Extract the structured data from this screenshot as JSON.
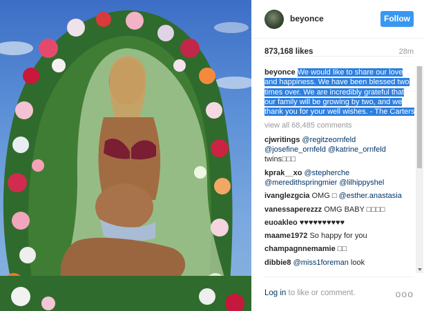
{
  "post": {
    "username": "beyonce",
    "follow_label": "Follow",
    "likes": "873,168 likes",
    "time": "28m",
    "caption_user": "beyonce",
    "caption_text": "We would like to share our love and happiness. We have been blessed two times over. We are incredibly grateful that our family will be growing by two, and we thank you for your well wishes. - The Carters",
    "view_all": "view all 68,485 comments"
  },
  "comments": [
    {
      "user": "cjwritings",
      "mentions": "@regitzeornfeld @josefine_ornfeld @katrine_ornfeld",
      "text": "twins□□□"
    },
    {
      "user": "kprak__xo",
      "mentions": "@stepherche @meredithspringmier @lilhippyshel",
      "text": ""
    },
    {
      "user": "ivanglezgcia",
      "text_before": "OMG □",
      "mentions": "@esther.anastasia",
      "text": ""
    },
    {
      "user": "vanessaperezzz",
      "text": "OMG BABY □□□□"
    },
    {
      "user": "euoakleo",
      "text": "♥♥♥♥♥♥♥♥♥♥"
    },
    {
      "user": "maame1972",
      "text": "So happy for you"
    },
    {
      "user": "champagnnemamie",
      "text": "□□"
    },
    {
      "user": "dibbie8",
      "mentions": "@miss1foreman",
      "text": "look"
    }
  ],
  "footer": {
    "login_label": "Log in",
    "rest": " to like or comment.",
    "more": "ooo"
  },
  "colors": {
    "follow": "#3897f0",
    "highlight": "#2b7fe1",
    "mention": "#003569"
  },
  "icons": {
    "more": "more-options-icon"
  }
}
